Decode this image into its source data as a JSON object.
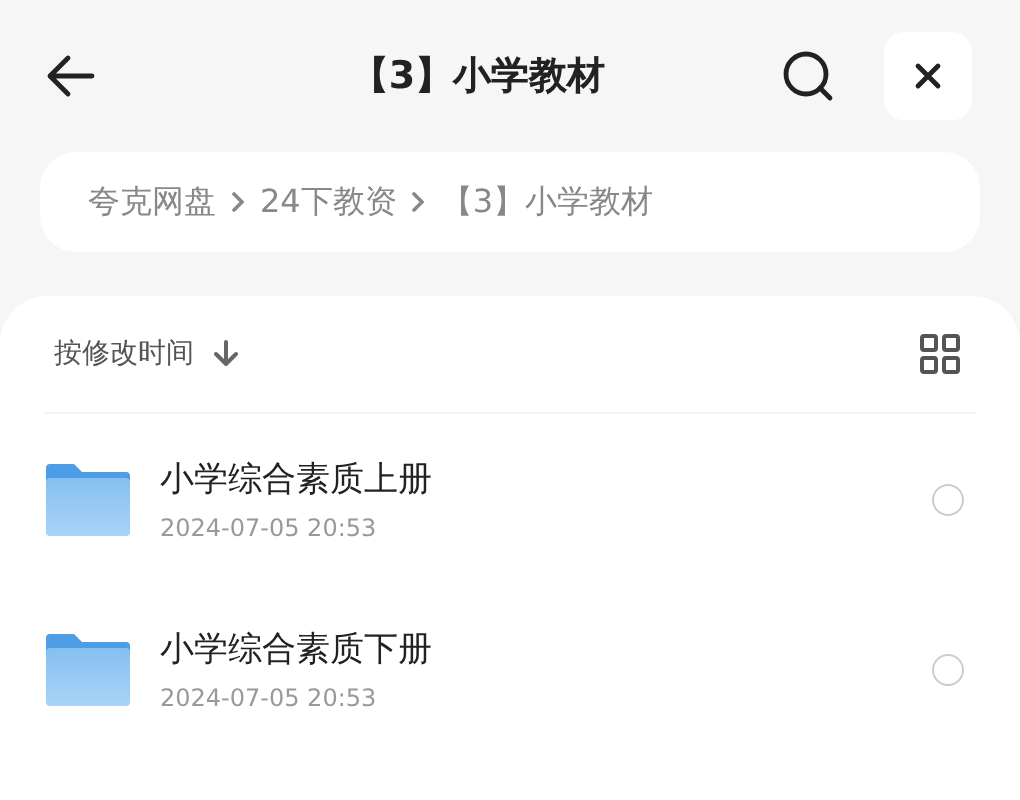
{
  "header": {
    "title": "【3】小学教材"
  },
  "breadcrumb": [
    "夸克网盘",
    "24下教资",
    "【3】小学教材"
  ],
  "sort": {
    "label": "按修改时间"
  },
  "files": [
    {
      "name": "小学综合素质上册",
      "date": "2024-07-05 20:53",
      "selected": false
    },
    {
      "name": "小学综合素质下册",
      "date": "2024-07-05 20:53",
      "selected": false
    }
  ]
}
